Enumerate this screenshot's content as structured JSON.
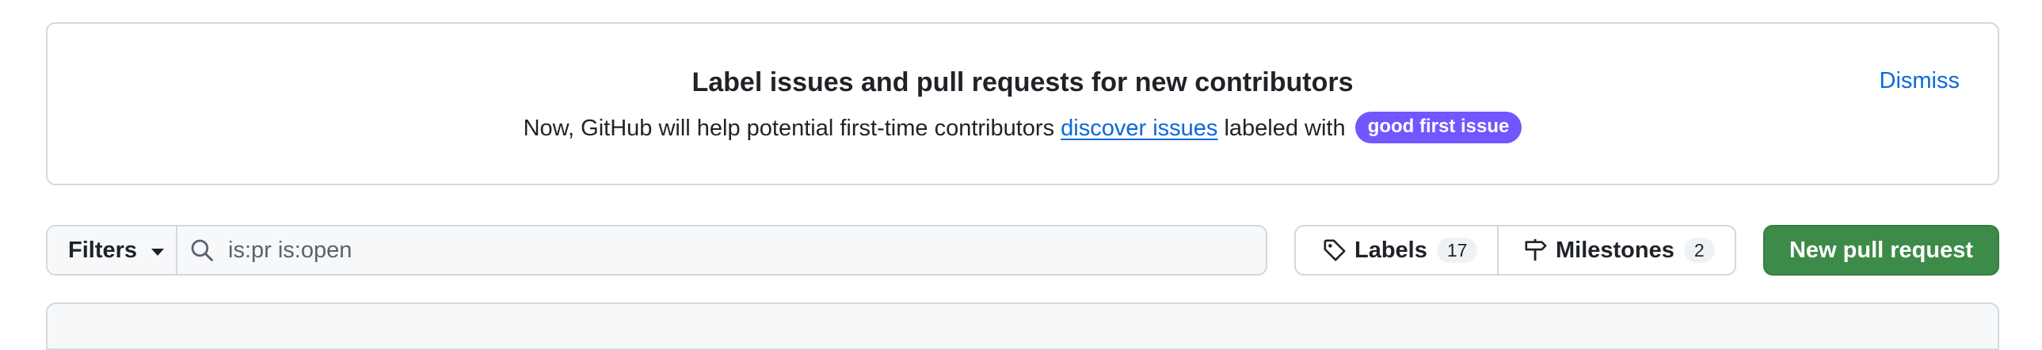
{
  "banner": {
    "title": "Label issues and pull requests for new contributors",
    "body_prefix": "Now, GitHub will help potential first-time contributors ",
    "link_text": "discover issues",
    "body_suffix": " labeled with ",
    "label_name": "good first issue",
    "label_color": "#7057ff",
    "dismiss_label": "Dismiss"
  },
  "toolbar": {
    "filters_label": "Filters",
    "search_value": "is:pr is:open",
    "labels_label": "Labels",
    "labels_count": "17",
    "milestones_label": "Milestones",
    "milestones_count": "2",
    "new_pr_label": "New pull request"
  },
  "icons": {
    "caret": "triangle-down-icon",
    "search": "search-icon",
    "tag": "tag-icon",
    "milestone": "milestone-icon"
  },
  "colors": {
    "accent": "#0969da",
    "primary_button": "#3d8b48",
    "border": "#d1d9e0"
  }
}
